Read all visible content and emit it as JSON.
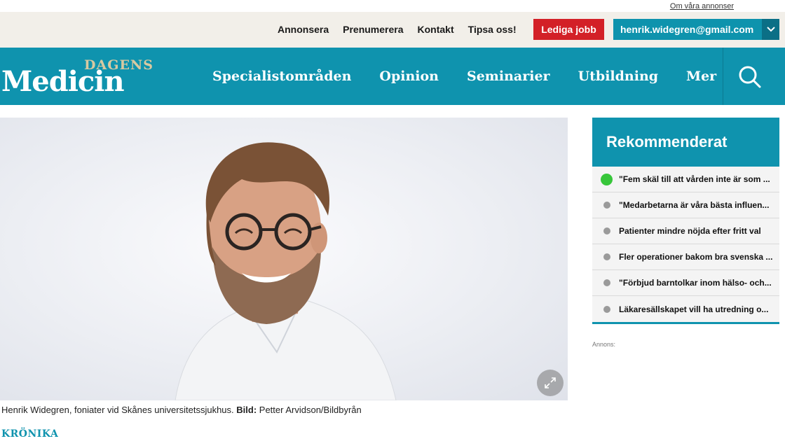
{
  "top_notice": {
    "link": "Om våra annonser"
  },
  "utility": {
    "links": [
      "Annonsera",
      "Prenumerera",
      "Kontakt",
      "Tipsa oss!"
    ],
    "jobs_button": "Lediga jobb",
    "user_email": "henrik.widegren@gmail.com"
  },
  "logo": {
    "top": "DAGENS",
    "main": "Medicin"
  },
  "nav": {
    "items": [
      "Specialistområden",
      "Opinion",
      "Seminarier",
      "Utbildning",
      "Mer"
    ]
  },
  "article": {
    "caption_text": "Henrik Widegren, foniater vid Skånes universitetssjukhus. ",
    "caption_bold": "Bild:",
    "caption_credit": " Petter Arvidson/Bildbyrån",
    "category": "KRÖNIKA"
  },
  "sidebar": {
    "title": "Rekommenderat",
    "items": [
      "\"Fem skäl till att vården inte är som ...",
      "\"Medarbetarna är våra bästa influen...",
      "Patienter mindre nöjda efter fritt val",
      "Fler operationer bakom bra svenska ...",
      "\"Förbjud barntolkar inom hälso- och...",
      "Läkaresällskapet vill ha utredning o..."
    ],
    "ad_label": "Annons:"
  },
  "colors": {
    "brand": "#0f93ae",
    "jobs": "#d32027",
    "live": "#37c63a"
  }
}
